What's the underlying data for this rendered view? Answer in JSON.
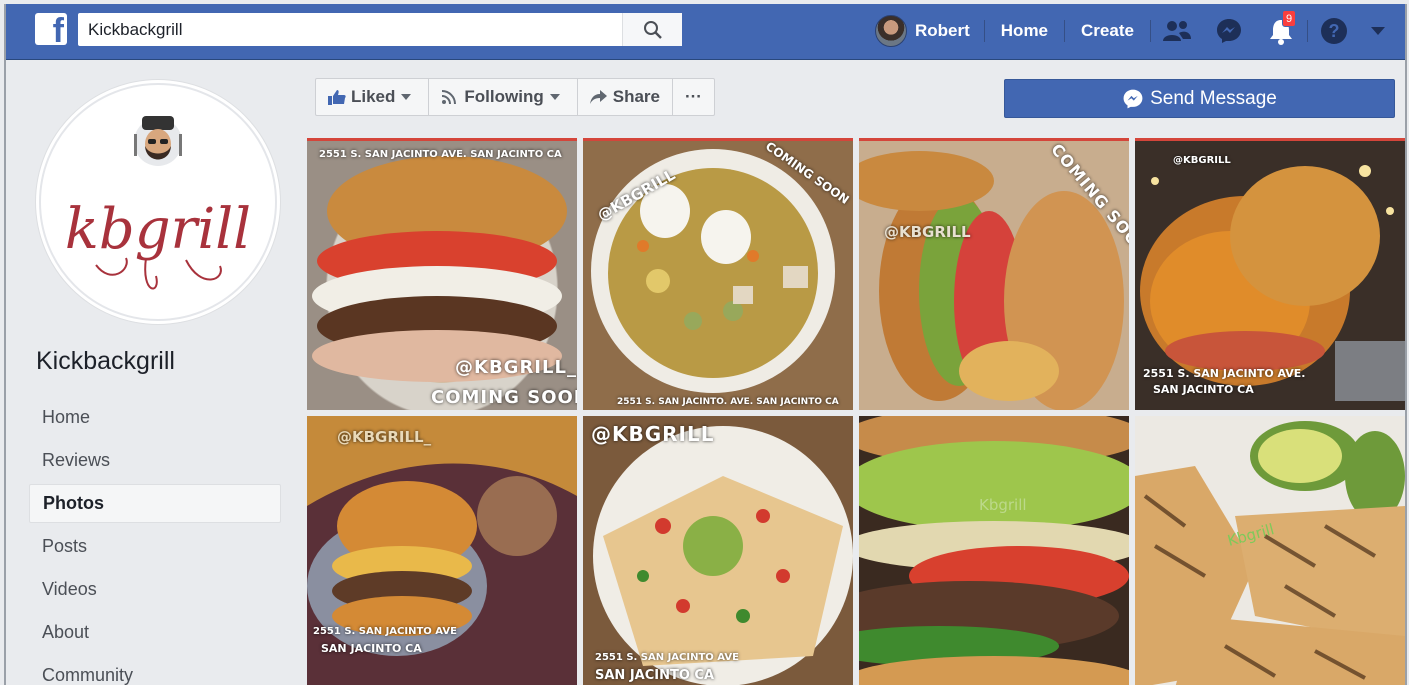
{
  "topbar": {
    "logo": "f",
    "search_value": "Kickbackgrill",
    "user_name": "Robert",
    "home_label": "Home",
    "create_label": "Create",
    "notification_count": "9"
  },
  "sidebar": {
    "page_name": "Kickbackgrill",
    "logo_text": "kbgrill",
    "items": [
      {
        "label": "Home"
      },
      {
        "label": "Reviews"
      },
      {
        "label": "Photos"
      },
      {
        "label": "Posts"
      },
      {
        "label": "Videos"
      },
      {
        "label": "About"
      },
      {
        "label": "Community"
      }
    ],
    "active_item": "Photos"
  },
  "actions": {
    "liked_label": "Liked",
    "following_label": "Following",
    "share_label": "Share",
    "more_label": "···",
    "send_message_label": "Send Message"
  },
  "photos": [
    {
      "address": "2551 S. SAN JACINTO AVE. SAN JACINTO CA",
      "handle": "@KBGRILL_",
      "tag": "COMING SOON"
    },
    {
      "handle": "@KBGRILL",
      "tag": "COMING SOON",
      "address": "2551 S. SAN JACINTO. AVE. SAN JACINTO CA"
    },
    {
      "tag": "COMING SOON",
      "handle": "@KBGRILL"
    },
    {
      "handle": "@KBGRILL",
      "address1": "2551 S. SAN JACINTO AVE.",
      "address2": "SAN JACINTO CA"
    },
    {
      "handle": "@KBGRILL_",
      "address1": "2551 S. SAN JACINTO AVE",
      "address2": "SAN JACINTO CA"
    },
    {
      "handle": "@KBGRILL",
      "address1": "2551 S. SAN JACINTO AVE",
      "address2": "SAN JACINTO CA"
    },
    {
      "handle": "Kbgrill"
    },
    {
      "handle": "Kbgrill"
    }
  ],
  "colors": {
    "brand": "#4267b2",
    "notification": "#fa3e3e",
    "logo_red": "#a8323c"
  }
}
